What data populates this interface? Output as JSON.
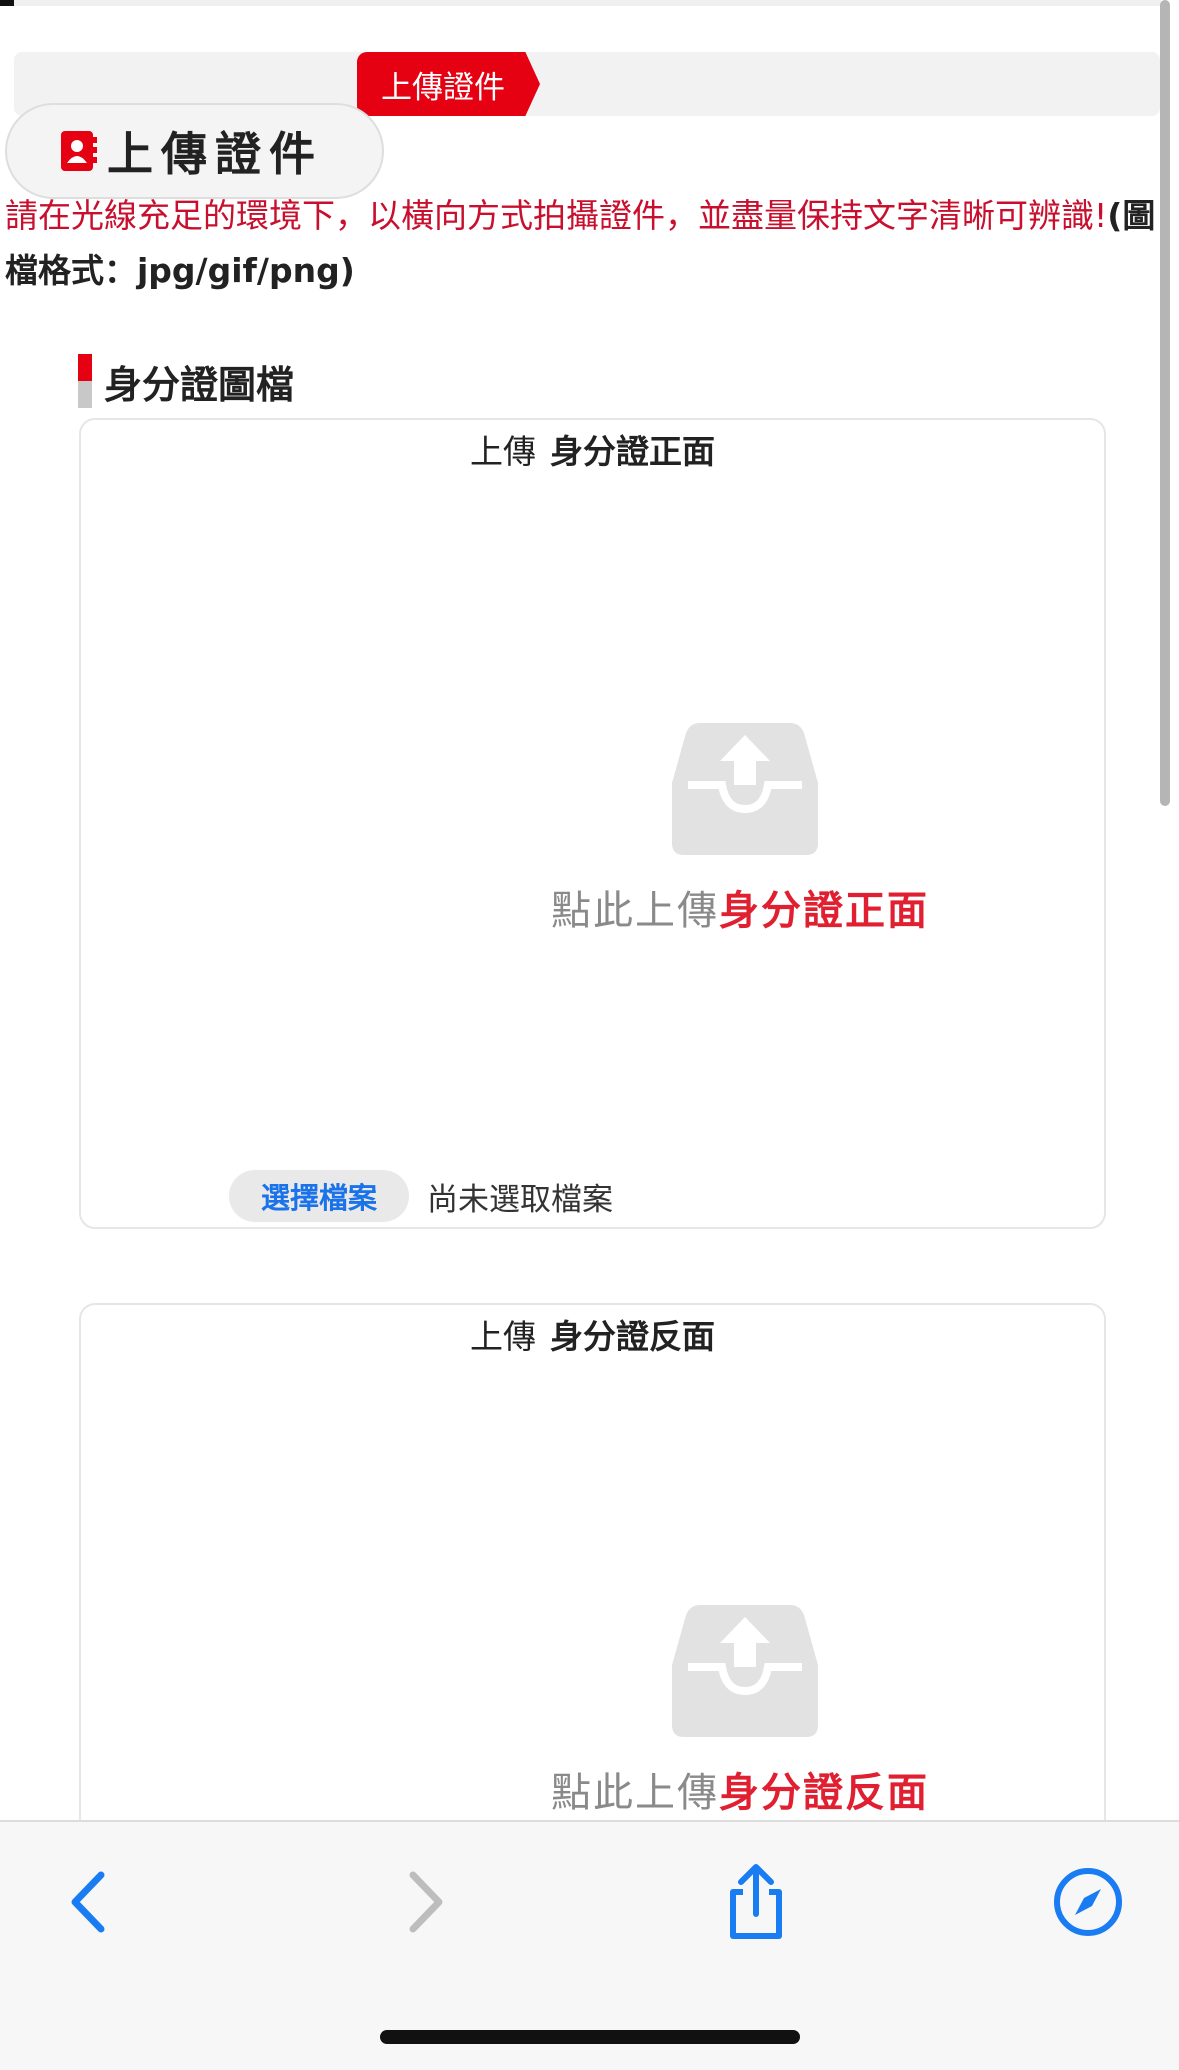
{
  "header": {
    "ribbon_label": "上傳證件",
    "page_title": "上傳證件"
  },
  "notice": {
    "red_text": "請在光線充足的環境下，以橫向方式拍攝證件，並盡量保持文字清晰可辨識!",
    "dark_text": "(圖檔格式：jpg/gif/png)"
  },
  "section": {
    "title": "身分證圖檔"
  },
  "cards": [
    {
      "head_prefix": "上傳",
      "head_bold": "身分證正面",
      "tap_prefix": "點此上傳",
      "tap_highlight": "身分證正面",
      "file_button": "選擇檔案",
      "file_status": "尚未選取檔案"
    },
    {
      "head_prefix": "上傳",
      "head_bold": "身分證反面",
      "tap_prefix": "點此上傳",
      "tap_highlight": "身分證反面"
    }
  ],
  "colors": {
    "brand_red": "#e50012",
    "link_blue": "#1a73e8",
    "safari_blue": "#1a7cf2"
  },
  "toolbar": {
    "icons": [
      "back-icon",
      "forward-icon",
      "share-icon",
      "compass-icon"
    ]
  }
}
